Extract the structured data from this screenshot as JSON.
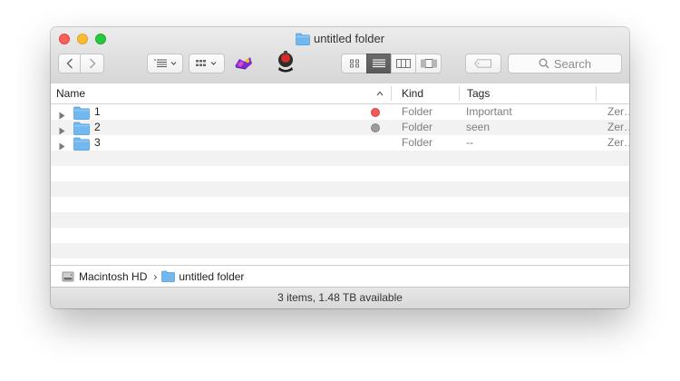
{
  "window": {
    "title": "untitled folder"
  },
  "toolbar": {
    "icons": [
      "back-arrow",
      "forward-arrow",
      "arrange-list",
      "action-grid",
      "app-shortcut-1",
      "app-shortcut-2",
      "view-icon",
      "view-list",
      "view-columns",
      "view-coverflow",
      "tag"
    ],
    "search_placeholder": "Search"
  },
  "columns": {
    "name": "Name",
    "kind": "Kind",
    "tags": "Tags"
  },
  "files": [
    {
      "name": "1",
      "kind": "Folder",
      "tags": "Important",
      "tag_color": "#f05b58",
      "extra": "Zer…"
    },
    {
      "name": "2",
      "kind": "Folder",
      "tags": "seen",
      "tag_color": "#9b9b9b",
      "extra": "Zer…"
    },
    {
      "name": "3",
      "kind": "Folder",
      "tags": "--",
      "tag_color": "",
      "extra": "Zer…"
    }
  ],
  "pathbar": {
    "drive": "Macintosh HD",
    "separator": "›",
    "folder": "untitled folder"
  },
  "status": "3 items, 1.48 TB available",
  "colors": {
    "folder_blue": "#72b8ef",
    "close": "#fc5f57",
    "minimize": "#fdbc2e",
    "zoom": "#28c840"
  }
}
